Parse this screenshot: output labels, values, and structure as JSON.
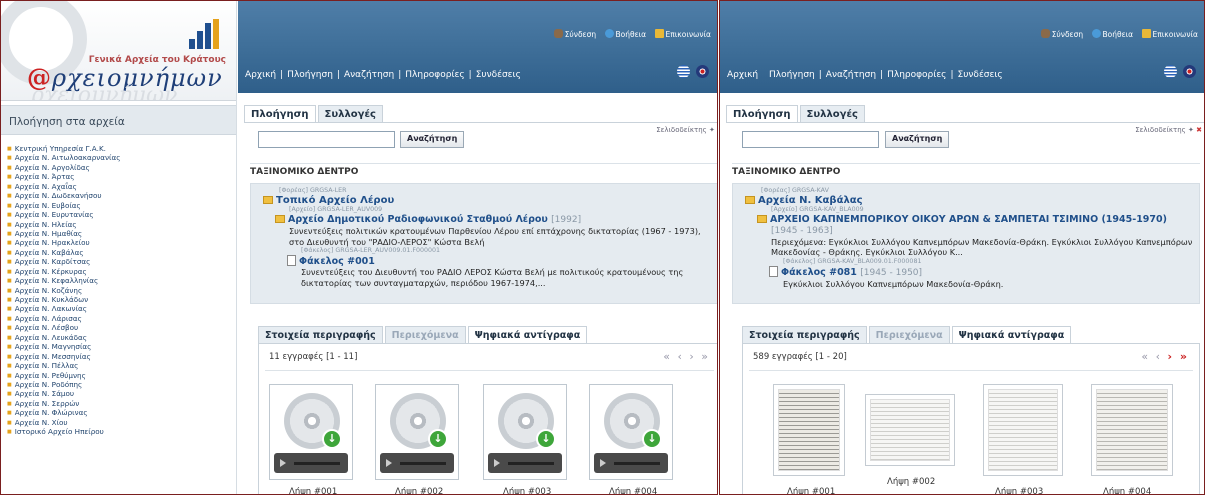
{
  "left": {
    "logo": {
      "subtitle": "Γενικά Αρχεία του Κράτους",
      "brand_at": "@",
      "brand_text": "ρχειομνήμων"
    },
    "sidebar": {
      "heading": "Πλοήγηση στα αρχεία",
      "items": [
        "Κεντρική Υπηρεσία Γ.Α.Κ.",
        "Αρχεία Ν. Αιτωλοακαρνανίας",
        "Αρχεία Ν. Αργολίδας",
        "Αρχεία Ν. Άρτας",
        "Αρχεία Ν. Αχαΐας",
        "Αρχεία Ν. Δωδεκανήσου",
        "Αρχεία Ν. Ευβοίας",
        "Αρχεία Ν. Ευρυτανίας",
        "Αρχεία Ν. Ηλείας",
        "Αρχεία Ν. Ημαθίας",
        "Αρχεία Ν. Ηρακλείου",
        "Αρχεία Ν. Καβάλας",
        "Αρχεία Ν. Καρδίτσας",
        "Αρχεία Ν. Κέρκυρας",
        "Αρχεία Ν. Κεφαλληνίας",
        "Αρχεία Ν. Κοζάνης",
        "Αρχεία Ν. Κυκλάδων",
        "Αρχεία Ν. Λακωνίας",
        "Αρχεία Ν. Λάρισας",
        "Αρχεία Ν. Λέσβου",
        "Αρχεία Ν. Λευκάδας",
        "Αρχεία Ν. Μαγνησίας",
        "Αρχεία Ν. Μεσσηνίας",
        "Αρχεία Ν. Πέλλας",
        "Αρχεία Ν. Ρεθύμνης",
        "Αρχεία Ν. Ροδόπης",
        "Αρχεία Ν. Σάμου",
        "Αρχεία Ν. Σερρών",
        "Αρχεία Ν. Φλώρινας",
        "Αρχεία Ν. Χίου",
        "Ιστορικό Αρχείο Ηπείρου"
      ]
    },
    "util": {
      "login": "Σύνδεση",
      "help": "Βοήθεια",
      "contact": "Επικοινωνία"
    },
    "nav": {
      "home": "Αρχική",
      "browse": "Πλοήγηση",
      "search": "Αναζήτηση",
      "info": "Πληροφορίες",
      "links": "Συνδέσεις"
    },
    "tabs": {
      "browse": "Πλοήγηση",
      "collections": "Συλλογές"
    },
    "bookmarks": "Σελιδοδείκτης",
    "search_button": "Αναζήτηση",
    "tree": {
      "heading": "ΤΑΞΙΝΟΜΙΚΟ ΔΕΝΤΡΟ",
      "ref1": "[Φορέας] GRGSA-LER",
      "title1": "Τοπικό Αρχείο Λέρου",
      "ref2": "[Αρχείο] GRGSA-LER_AUV009",
      "title2": "Αρχείο Δημοτικού Ραδιοφωνικού Σταθμού Λέρου",
      "date2": "[1992]",
      "desc2": "Συνεντεύξεις πολιτικών κρατουμένων Παρθενίου Λέρου επί επτάχρονης δικτατορίας (1967 - 1973), στο Διευθυντή του \"ΡΑΔΙΟ-ΛΕΡΟΣ\" Κώστα Βελή",
      "ref3": "[Φάκελος] GRGSA-LER_AUV009.01.F000001",
      "title3": "Φάκελος #001",
      "desc3": "Συνεντεύξεις του Διευθυντή του ΡΑΔΙΟ ΛΕΡΟΣ Κώστα Βελή με πολιτικούς κρατουμένους της δικτατορίας των συνταγματαρχών, περιόδου 1967-1974,..."
    },
    "tabs2": {
      "description": "Στοιχεία περιγραφής",
      "contents": "Περιεχόμενα",
      "digital": "Ψηφιακά αντίγραφα"
    },
    "count": "11 εγγραφές [1 - 11]",
    "pager": "« ‹ › »",
    "captions": [
      "Λήψη #001",
      "Λήψη #002",
      "Λήψη #003",
      "Λήψη #004"
    ]
  },
  "right": {
    "util": {
      "login": "Σύνδεση",
      "help": "Βοήθεια",
      "contact": "Επικοινωνία"
    },
    "nav": {
      "home": "Αρχική",
      "browse": "Πλοήγηση",
      "search": "Αναζήτηση",
      "info": "Πληροφορίες",
      "links": "Συνδέσεις"
    },
    "tabs": {
      "browse": "Πλοήγηση",
      "collections": "Συλλογές"
    },
    "bookmarks": "Σελιδοδείκτης",
    "search_button": "Αναζήτηση",
    "tree": {
      "heading": "ΤΑΞΙΝΟΜΙΚΟ ΔΕΝΤΡΟ",
      "ref1": "[Φορέας] GRGSA-KAV",
      "title1": "Αρχεία Ν. Καβάλας",
      "ref2": "[Αρχείο] GRGSA-KAV_BLA009",
      "title2": "ΑΡΧΕΙΟ ΚΑΠΝΕΜΠΟΡΙΚΟΥ ΟΙΚΟΥ ΑΡΩΝ & ΣΑΜΠΕΤΑΙ ΤΣΙΜΙΝΟ (1945-1970)",
      "date2": "[1945 - 1963]",
      "desc2": "Περιεχόμενα: Εγκύκλιοι Συλλόγου Καπνεμπόρων Μακεδονία-Θράκη. Εγκύκλιοι Συλλόγου Καπνεμπόρων Μακεδονίας - Θράκης. Εγκύκλιοι Συλλόγου Κ...",
      "ref3": "[Φάκελος] GRGSA-KAV_BLA009.01.F000081",
      "title3": "Φάκελος #081",
      "date3": "[1945 - 1950]",
      "desc3": "Εγκύκλιοι Συλλόγου Καπνεμπόρων Μακεδονία-Θράκη."
    },
    "tabs2": {
      "description": "Στοιχεία περιγραφής",
      "contents": "Περιεχόμενα",
      "digital": "Ψηφιακά αντίγραφα"
    },
    "count": "589 εγγραφές [1 - 20]",
    "pager_prev": "« ‹",
    "pager_next": "› »",
    "captions": [
      "Λήψη #001",
      "Λήψη #002",
      "Λήψη #003",
      "Λήψη #004"
    ]
  },
  "colors": {
    "topbar": "#3f6f99",
    "accent_red": "#c22",
    "link": "#1f4f8a",
    "bullet": "#e5a21b"
  }
}
